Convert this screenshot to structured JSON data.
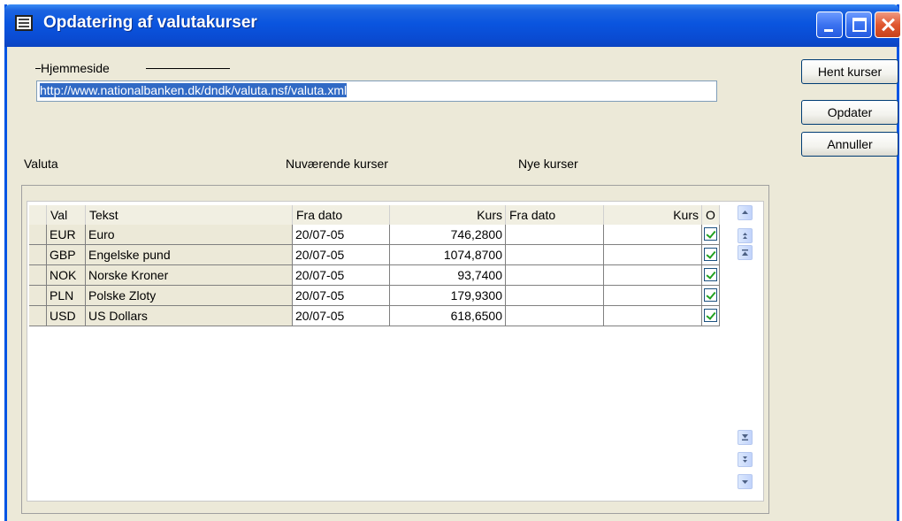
{
  "window": {
    "title": "Opdatering af valutakurser"
  },
  "homepage": {
    "label": "Hjemmeside",
    "url": "http://www.nationalbanken.dk/dndk/valuta.nsf/valuta.xml"
  },
  "buttons": {
    "fetch": "Hent kurser",
    "update": "Opdater",
    "cancel": "Annuller"
  },
  "section_headers": {
    "valuta": "Valuta",
    "current": "Nuværende kurser",
    "new": "Nye kurser"
  },
  "grid": {
    "columns": {
      "val": "Val",
      "tekst": "Tekst",
      "fra_dato": "Fra dato",
      "kurs": "Kurs",
      "ny_fra_dato": "Fra dato",
      "ny_kurs": "Kurs",
      "o": "O"
    },
    "rows": [
      {
        "val": "EUR",
        "tekst": "Euro",
        "fra_dato": "20/07-05",
        "kurs": "746,2800",
        "ny_fra_dato": "",
        "ny_kurs": "",
        "checked": true
      },
      {
        "val": "GBP",
        "tekst": "Engelske pund",
        "fra_dato": "20/07-05",
        "kurs": "1074,8700",
        "ny_fra_dato": "",
        "ny_kurs": "",
        "checked": true
      },
      {
        "val": "NOK",
        "tekst": "Norske Kroner",
        "fra_dato": "20/07-05",
        "kurs": "93,7400",
        "ny_fra_dato": "",
        "ny_kurs": "",
        "checked": true
      },
      {
        "val": "PLN",
        "tekst": "Polske Zloty",
        "fra_dato": "20/07-05",
        "kurs": "179,9300",
        "ny_fra_dato": "",
        "ny_kurs": "",
        "checked": true
      },
      {
        "val": "USD",
        "tekst": "US Dollars",
        "fra_dato": "20/07-05",
        "kurs": "618,6500",
        "ny_fra_dato": "",
        "ny_kurs": "",
        "checked": true
      }
    ]
  },
  "icons": {
    "app": "document-list-icon",
    "minimize": "minimize-icon",
    "maximize": "maximize-icon",
    "close": "close-icon",
    "scroll_up": "arrow-up-icon",
    "page_up": "page-up-icon",
    "first": "scroll-top-icon",
    "last": "scroll-bottom-icon",
    "page_down": "page-down-icon",
    "scroll_down": "arrow-down-icon"
  }
}
